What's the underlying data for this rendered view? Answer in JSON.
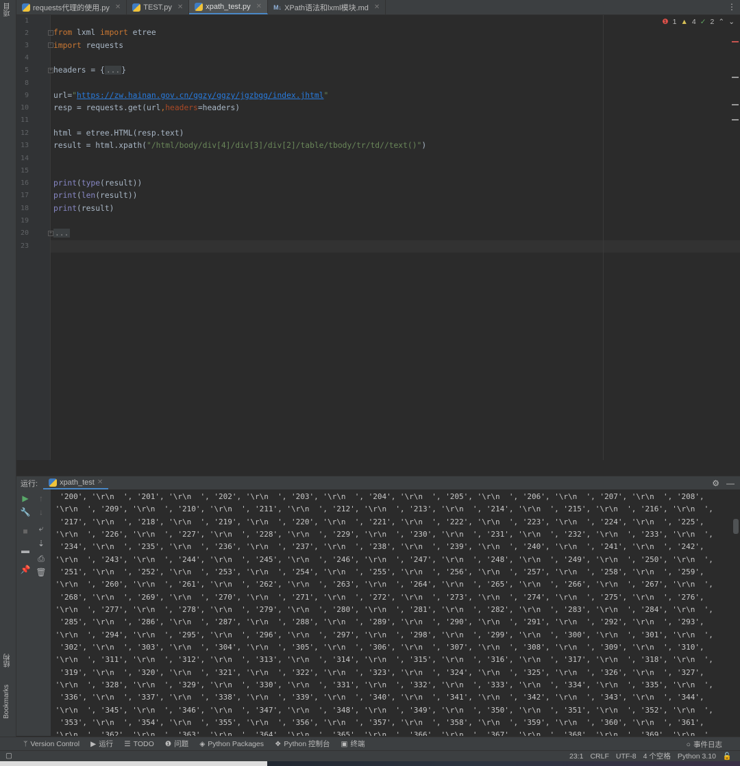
{
  "left_strip": {
    "project_label": "项目",
    "structure_label": "结构",
    "bookmarks_label": "Bookmarks"
  },
  "tabs": [
    {
      "label": "requests代理的使用.py",
      "icon": "python-file-icon",
      "active": false
    },
    {
      "label": "TEST.py",
      "icon": "python-file-icon",
      "active": false
    },
    {
      "label": "xpath_test.py",
      "icon": "python-file-icon",
      "active": true
    },
    {
      "label": "XPath语法和lxml模块.md",
      "icon": "markdown-file-icon",
      "active": false
    }
  ],
  "inspection": {
    "errors": "1",
    "warnings": "4",
    "weak_warnings": "2"
  },
  "editor": {
    "line_numbers": [
      "1",
      "2",
      "3",
      "4",
      "5",
      "8",
      "9",
      "10",
      "11",
      "12",
      "13",
      "14",
      "15",
      "16",
      "17",
      "18",
      "19",
      "20",
      "23"
    ],
    "lines": {
      "l2_kw1": "from",
      "l2_mod": " lxml ",
      "l2_kw2": "import",
      "l2_name": " etree",
      "l3_kw": "import",
      "l3_name": " requests",
      "l5_pre": "headers = {",
      "l5_fold": "...",
      "l5_post": "}",
      "l9_pre": "url=",
      "l9_q1": "\"",
      "l9_url": "https://zw.hainan.gov.cn/ggzy/ggzy/jgzbgg/index.jhtml",
      "l9_q2": "\"",
      "l10_pre": "resp = requests.get(url",
      "l10_comma": ",",
      "l10_param": "headers",
      "l10_post": "=headers)",
      "l12": "html = etree.HTML(resp.text)",
      "l13_pre": "result = html.xpath(",
      "l13_str": "\"/html/body/div[4]/div[3]/div[2]/table/tbody/tr/td//text()\"",
      "l13_post": ")",
      "l16_fn": "print",
      "l16_p": "(",
      "l16_fn2": "type",
      "l16_post": "(result))",
      "l17_fn": "print",
      "l17_p": "(",
      "l17_fn2": "len",
      "l17_post": "(result))",
      "l18_fn": "print",
      "l18_post": "(result)",
      "l20_fold": "..."
    }
  },
  "run_panel": {
    "label": "运行:",
    "tab": "xpath_test",
    "output": [
      "  '200', '\\r\\n  ', '201', '\\r\\n  ', '202', '\\r\\n  ', '203', '\\r\\n  ', '204', '\\r\\n  ', '205', '\\r\\n  ', '206', '\\r\\n  ', '207', '\\r\\n  ', '208',",
      " '\\r\\n  ', '209', '\\r\\n  ', '210', '\\r\\n  ', '211', '\\r\\n  ', '212', '\\r\\n  ', '213', '\\r\\n  ', '214', '\\r\\n  ', '215', '\\r\\n  ', '216', '\\r\\n  ',",
      "  '217', '\\r\\n  ', '218', '\\r\\n  ', '219', '\\r\\n  ', '220', '\\r\\n  ', '221', '\\r\\n  ', '222', '\\r\\n  ', '223', '\\r\\n  ', '224', '\\r\\n  ', '225',",
      " '\\r\\n  ', '226', '\\r\\n  ', '227', '\\r\\n  ', '228', '\\r\\n  ', '229', '\\r\\n  ', '230', '\\r\\n  ', '231', '\\r\\n  ', '232', '\\r\\n  ', '233', '\\r\\n  ',",
      "  '234', '\\r\\n  ', '235', '\\r\\n  ', '236', '\\r\\n  ', '237', '\\r\\n  ', '238', '\\r\\n  ', '239', '\\r\\n  ', '240', '\\r\\n  ', '241', '\\r\\n  ', '242',",
      " '\\r\\n  ', '243', '\\r\\n  ', '244', '\\r\\n  ', '245', '\\r\\n  ', '246', '\\r\\n  ', '247', '\\r\\n  ', '248', '\\r\\n  ', '249', '\\r\\n  ', '250', '\\r\\n  ',",
      "  '251', '\\r\\n  ', '252', '\\r\\n  ', '253', '\\r\\n  ', '254', '\\r\\n  ', '255', '\\r\\n  ', '256', '\\r\\n  ', '257', '\\r\\n  ', '258', '\\r\\n  ', '259',",
      " '\\r\\n  ', '260', '\\r\\n  ', '261', '\\r\\n  ', '262', '\\r\\n  ', '263', '\\r\\n  ', '264', '\\r\\n  ', '265', '\\r\\n  ', '266', '\\r\\n  ', '267', '\\r\\n  ',",
      "  '268', '\\r\\n  ', '269', '\\r\\n  ', '270', '\\r\\n  ', '271', '\\r\\n  ', '272', '\\r\\n  ', '273', '\\r\\n  ', '274', '\\r\\n  ', '275', '\\r\\n  ', '276',",
      " '\\r\\n  ', '277', '\\r\\n  ', '278', '\\r\\n  ', '279', '\\r\\n  ', '280', '\\r\\n  ', '281', '\\r\\n  ', '282', '\\r\\n  ', '283', '\\r\\n  ', '284', '\\r\\n  ',",
      "  '285', '\\r\\n  ', '286', '\\r\\n  ', '287', '\\r\\n  ', '288', '\\r\\n  ', '289', '\\r\\n  ', '290', '\\r\\n  ', '291', '\\r\\n  ', '292', '\\r\\n  ', '293',",
      " '\\r\\n  ', '294', '\\r\\n  ', '295', '\\r\\n  ', '296', '\\r\\n  ', '297', '\\r\\n  ', '298', '\\r\\n  ', '299', '\\r\\n  ', '300', '\\r\\n  ', '301', '\\r\\n  ',",
      "  '302', '\\r\\n  ', '303', '\\r\\n  ', '304', '\\r\\n  ', '305', '\\r\\n  ', '306', '\\r\\n  ', '307', '\\r\\n  ', '308', '\\r\\n  ', '309', '\\r\\n  ', '310',",
      " '\\r\\n  ', '311', '\\r\\n  ', '312', '\\r\\n  ', '313', '\\r\\n  ', '314', '\\r\\n  ', '315', '\\r\\n  ', '316', '\\r\\n  ', '317', '\\r\\n  ', '318', '\\r\\n  ',",
      "  '319', '\\r\\n  ', '320', '\\r\\n  ', '321', '\\r\\n  ', '322', '\\r\\n  ', '323', '\\r\\n  ', '324', '\\r\\n  ', '325', '\\r\\n  ', '326', '\\r\\n  ', '327',",
      " '\\r\\n  ', '328', '\\r\\n  ', '329', '\\r\\n  ', '330', '\\r\\n  ', '331', '\\r\\n  ', '332', '\\r\\n  ', '333', '\\r\\n  ', '334', '\\r\\n  ', '335', '\\r\\n  ',",
      "  '336', '\\r\\n  ', '337', '\\r\\n  ', '338', '\\r\\n  ', '339', '\\r\\n  ', '340', '\\r\\n  ', '341', '\\r\\n  ', '342', '\\r\\n  ', '343', '\\r\\n  ', '344',",
      " '\\r\\n  ', '345', '\\r\\n  ', '346', '\\r\\n  ', '347', '\\r\\n  ', '348', '\\r\\n  ', '349', '\\r\\n  ', '350', '\\r\\n  ', '351', '\\r\\n  ', '352', '\\r\\n  ',",
      "  '353', '\\r\\n  ', '354', '\\r\\n  ', '355', '\\r\\n  ', '356', '\\r\\n  ', '357', '\\r\\n  ', '358', '\\r\\n  ', '359', '\\r\\n  ', '360', '\\r\\n  ', '361',",
      " '\\r\\n  ', '362', '\\r\\n  ', '363', '\\r\\n  ', '364', '\\r\\n  ', '365', '\\r\\n  ', '366', '\\r\\n  ', '367', '\\r\\n  ', '368', '\\r\\n  ', '369', '\\r\\n  ',"
    ]
  },
  "bottom_toolbar": {
    "version_control": "Version Control",
    "run": "运行",
    "todo": "TODO",
    "problems": "问题",
    "python_packages": "Python Packages",
    "python_console": "Python 控制台",
    "terminal": "终端",
    "event_log": "事件日志"
  },
  "status_bar": {
    "position": "23:1",
    "line_sep": "CRLF",
    "encoding": "UTF-8",
    "indent": "4 个空格",
    "interpreter": "Python 3.10"
  },
  "colors": {
    "accent": "#4a88c7",
    "editor_bg": "#2b2b2b",
    "panel_bg": "#3c3f41",
    "keyword": "#cc7832",
    "string": "#6a8759"
  }
}
